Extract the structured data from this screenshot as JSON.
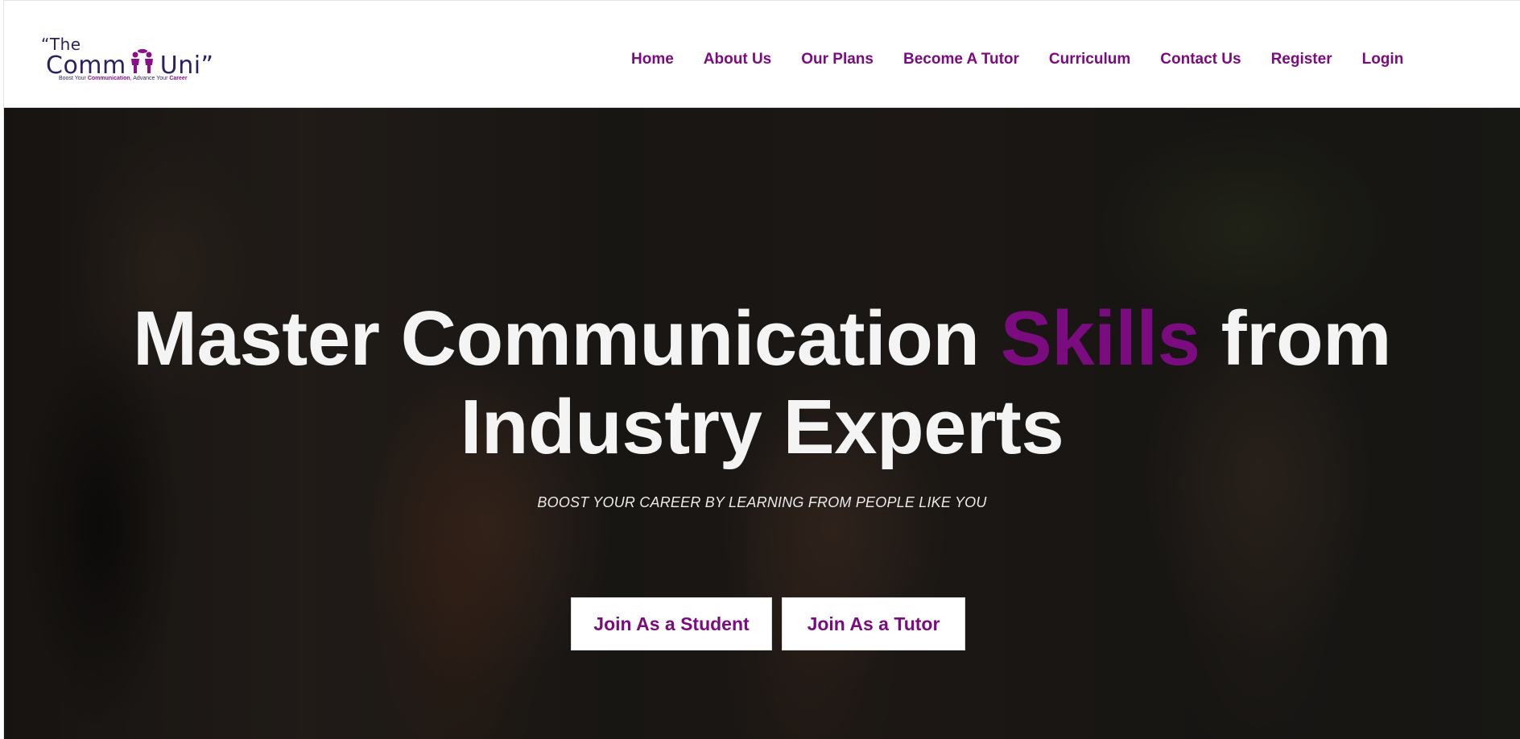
{
  "logo": {
    "quote_top": "“The",
    "name_left": "Comm",
    "name_right": "Uni”",
    "tagline_prefix": "Boost Your ",
    "tagline_hl1": "Communication",
    "tagline_mid": ", Advance Your ",
    "tagline_hl2": "Career",
    "brand_color": "#2d1f63",
    "accent_color": "#8a0f8a",
    "icon": "people-icon"
  },
  "nav": {
    "items": [
      {
        "label": "Home"
      },
      {
        "label": "About Us"
      },
      {
        "label": "Our Plans"
      },
      {
        "label": "Become A Tutor"
      },
      {
        "label": "Curriculum"
      },
      {
        "label": "Contact Us"
      },
      {
        "label": "Register"
      },
      {
        "label": "Login"
      }
    ],
    "color": "#7a0c80"
  },
  "hero": {
    "title_part1": "Master Communication ",
    "title_accent": "Skills",
    "title_part2": " from",
    "title_line2": "Industry Experts",
    "subtitle": "BOOST YOUR CAREER BY LEARNING FROM PEOPLE LIKE YOU",
    "accent_color": "#7a0c80",
    "buttons": {
      "student": "Join As a Student",
      "tutor": "Join As a Tutor"
    }
  }
}
